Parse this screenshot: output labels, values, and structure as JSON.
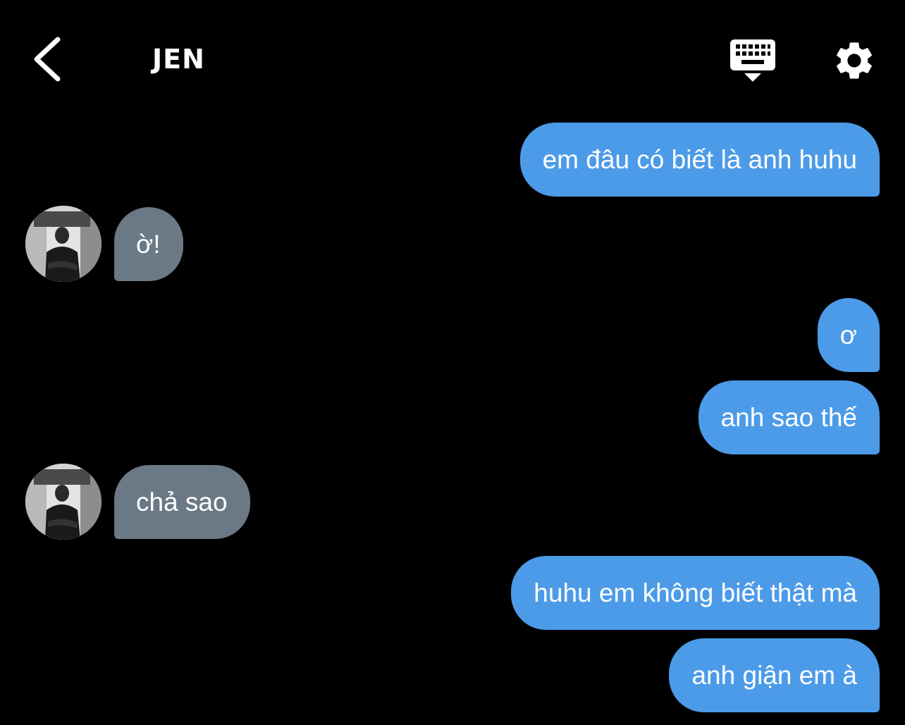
{
  "header": {
    "title": "JEN",
    "back_icon": "chevron-left-icon",
    "keyboard_icon": "keyboard-hide-icon",
    "settings_icon": "gear-icon"
  },
  "colors": {
    "background": "#000000",
    "sent_bubble": "#4c9be8",
    "received_bubble": "#6b7886",
    "text": "#ffffff"
  },
  "messages": [
    {
      "direction": "sent",
      "text": "em đâu có biết là anh huhu"
    },
    {
      "direction": "received",
      "text": "ờ!"
    },
    {
      "direction": "sent",
      "text": "ơ"
    },
    {
      "direction": "sent",
      "text": "anh sao thế"
    },
    {
      "direction": "received",
      "text": "chả sao"
    },
    {
      "direction": "sent",
      "text": "huhu em không biết thật mà"
    },
    {
      "direction": "sent",
      "text": "anh giận em à"
    }
  ]
}
